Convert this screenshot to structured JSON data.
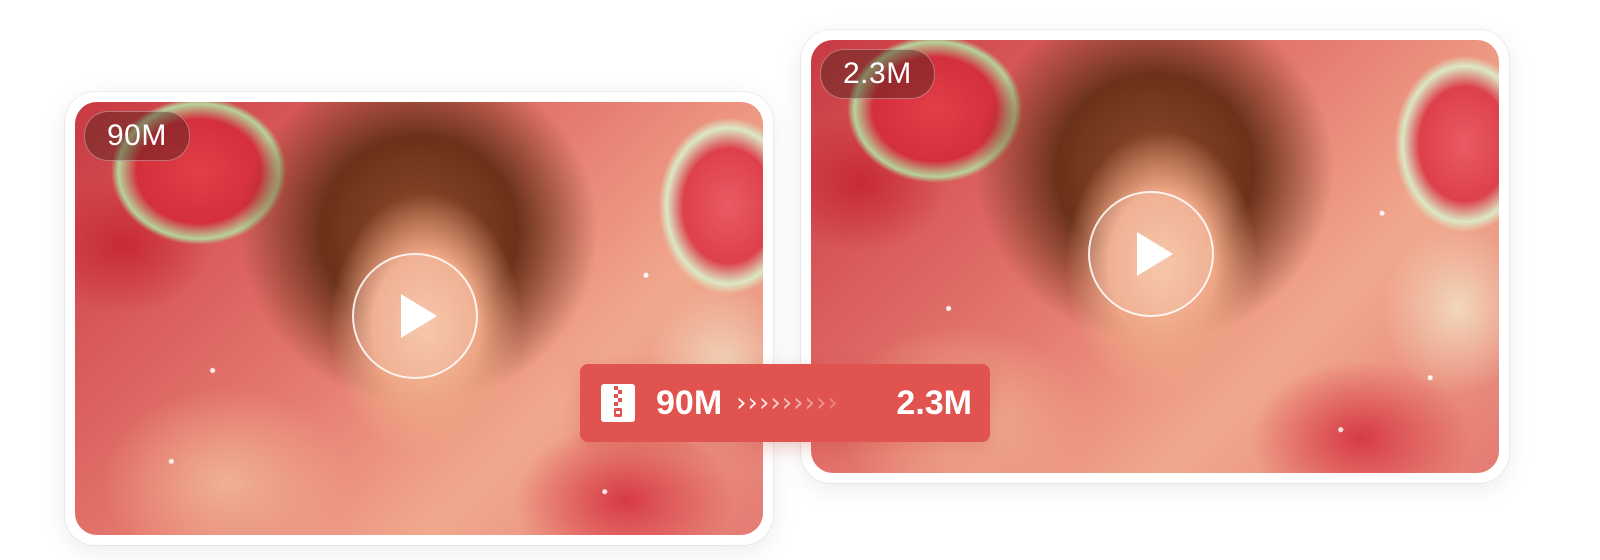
{
  "original_video": {
    "size_label": "90M",
    "play_icon": "play-icon"
  },
  "compressed_video": {
    "size_label": "2.3M",
    "play_icon": "play-icon"
  },
  "compression": {
    "icon": "zip-file-icon",
    "from": "90M",
    "arrow_glyph": "›",
    "to": "2.3M",
    "bar_color": "#e0534f"
  }
}
